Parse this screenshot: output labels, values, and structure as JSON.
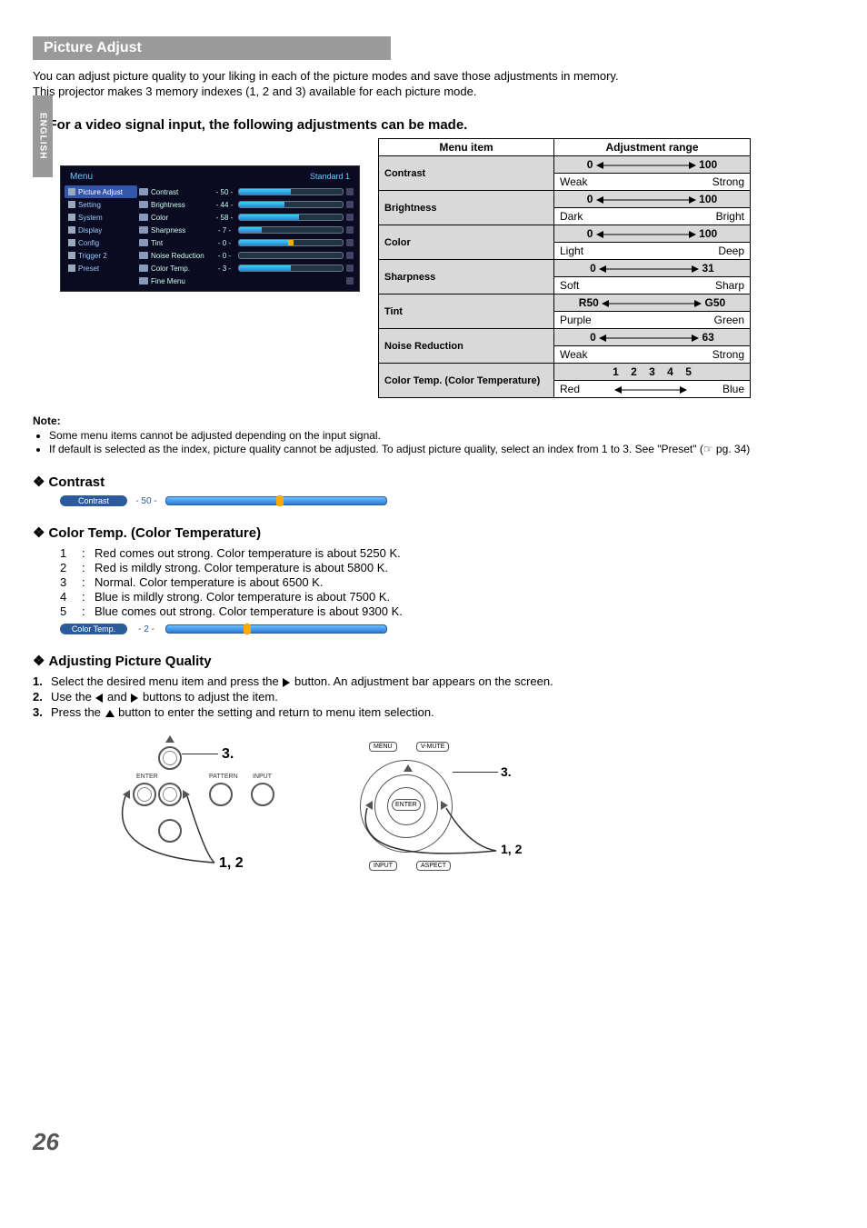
{
  "lang_tab": "ENGLISH",
  "section_title": "Picture Adjust",
  "intro": {
    "line1": "You can adjust picture quality to your liking in each of the picture modes and save those adjustments in memory.",
    "line2": "This projector makes 3 memory indexes (1, 2 and 3) available for each picture mode."
  },
  "heading1": "For a video signal input, the following adjustments can be made.",
  "osd": {
    "menu_label": "Menu",
    "preset_label": "Standard 1",
    "sidebar": [
      "Picture Adjust",
      "Setting",
      "System",
      "Display",
      "Config",
      "Trigger 2",
      "Preset"
    ],
    "rows": [
      {
        "label": "Contrast",
        "val": "- 50 -",
        "fill": 50
      },
      {
        "label": "Brightness",
        "val": "- 44 -",
        "fill": 44
      },
      {
        "label": "Color",
        "val": "- 58 -",
        "fill": 58
      },
      {
        "label": "Sharpness",
        "val": "- 7 -",
        "fill": 22
      },
      {
        "label": "Tint",
        "val": "- 0 -",
        "fill": 50,
        "thumb": 50
      },
      {
        "label": "Noise Reduction",
        "val": "- 0 -",
        "fill": 0
      },
      {
        "label": "Color Temp.",
        "val": "- 3 -",
        "fill": 50
      },
      {
        "label": "Fine Menu",
        "val": "",
        "fill": null
      }
    ]
  },
  "table": {
    "head_item": "Menu item",
    "head_range": "Adjustment range",
    "rows": [
      {
        "item": "Contrast",
        "low": "0",
        "high": "100",
        "descLow": "Weak",
        "descHigh": "Strong"
      },
      {
        "item": "Brightness",
        "low": "0",
        "high": "100",
        "descLow": "Dark",
        "descHigh": "Bright"
      },
      {
        "item": "Color",
        "low": "0",
        "high": "100",
        "descLow": "Light",
        "descHigh": "Deep"
      },
      {
        "item": "Sharpness",
        "low": "0",
        "high": "31",
        "descLow": "Soft",
        "descHigh": "Sharp"
      },
      {
        "item": "Tint",
        "low": "R50",
        "high": "G50",
        "descLow": "Purple",
        "descHigh": "Green"
      },
      {
        "item": "Noise Reduction",
        "low": "0",
        "high": "63",
        "descLow": "Weak",
        "descHigh": "Strong"
      },
      {
        "item": "Color Temp. (Color Temperature)",
        "low": "1",
        "mid": "2     3     4",
        "high": "5",
        "descLow": "Red",
        "descHigh": "Blue"
      }
    ]
  },
  "note": {
    "label": "Note:",
    "items": [
      "Some menu items cannot be adjusted depending on the input signal.",
      "If default is selected as the index, picture quality cannot be adjusted. To adjust picture quality, select an index from 1 to 3. See \"Preset\" (☞ pg. 34)"
    ]
  },
  "contrast_heading": "Contrast",
  "contrast_slider": {
    "label": "Contrast",
    "val": "- 50 -",
    "thumb": 50
  },
  "colortemp_heading": "Color Temp. (Color Temperature)",
  "colortemp_list": [
    {
      "num": "1",
      "text": "Red comes out strong. Color temperature is about 5250 K."
    },
    {
      "num": "2",
      "text": "Red is mildly strong. Color temperature is about 5800 K."
    },
    {
      "num": "3",
      "text": "Normal. Color temperature is about 6500 K."
    },
    {
      "num": "4",
      "text": "Blue is mildly strong. Color temperature is about 7500 K."
    },
    {
      "num": "5",
      "text": "Blue comes out strong. Color temperature is about 9300 K."
    }
  ],
  "colortemp_slider": {
    "label": "Color Temp.",
    "val": "- 2 -",
    "thumb": 35
  },
  "adj_heading": "Adjusting Picture Quality",
  "steps": [
    {
      "num": "1.",
      "pre": "Select the desired menu item and press the ",
      "post": " button. An adjustment bar appears on the screen."
    },
    {
      "num": "2.",
      "pre": "Use the ",
      "mid": " and ",
      "post": " buttons to adjust the item."
    },
    {
      "num": "3.",
      "pre": "Press the ",
      "post": " button to enter the setting and return to menu item selection."
    }
  ],
  "dia1": {
    "enter": "ENTER",
    "pattern": "PATTERN",
    "input": "INPUT",
    "step3": "3.",
    "step12": "1, 2"
  },
  "dia2": {
    "menu": "MENU",
    "vmute": "V-MUTE",
    "enter": "ENTER",
    "input": "INPUT",
    "aspect": "ASPECT",
    "step3": "3.",
    "step12": "1, 2"
  },
  "page_number": "26"
}
